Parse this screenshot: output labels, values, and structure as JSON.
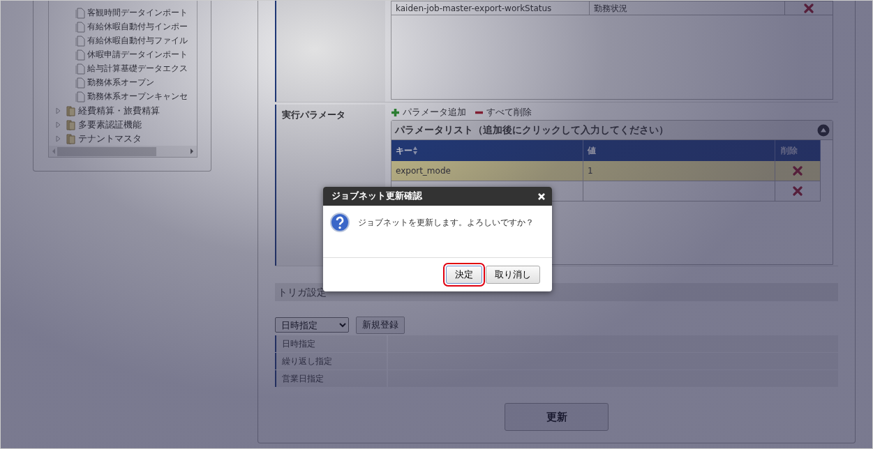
{
  "tree": {
    "leaves": [
      "客観時間データインポート",
      "有給休暇自動付与インポー",
      "有給休暇自動付与ファイル",
      "休暇申請データインポート",
      "給与計算基礎データエクス",
      "勤務体系オープン",
      "勤務体系オープンキャンセ"
    ],
    "folders": [
      {
        "label": "経費精算・旅費精算",
        "expanded": false
      },
      {
        "label": "多要素認証機能",
        "expanded": false
      },
      {
        "label": "テナントマスタ",
        "expanded": false
      }
    ]
  },
  "job_list": {
    "rows": [
      {
        "column_1": "kaiden-job-master-export-workStatus",
        "column_2": "勤務状況"
      }
    ]
  },
  "params": {
    "label": "実行パラメータ",
    "add": "パラメータ追加",
    "clear": "すべて削除",
    "list_title": "パラメータリスト（追加後にクリックして入力してください）",
    "columns": [
      "キー",
      "値",
      "削除"
    ],
    "rows": [
      {
        "key": "export_mode",
        "value": "1",
        "selected": true
      },
      {
        "selected": false
      }
    ]
  },
  "trigger": {
    "title": "トリガ設定",
    "select_value": "日時指定",
    "new_button": "新規登録",
    "rows": [
      "日時指定",
      "繰り返し指定",
      "営業日指定"
    ]
  },
  "update_button": "更新",
  "dialog": {
    "title": "ジョブネット更新確認",
    "message": "ジョブネットを更新します。よろしいですか？",
    "ok": "決定",
    "cancel": "取り消し"
  }
}
